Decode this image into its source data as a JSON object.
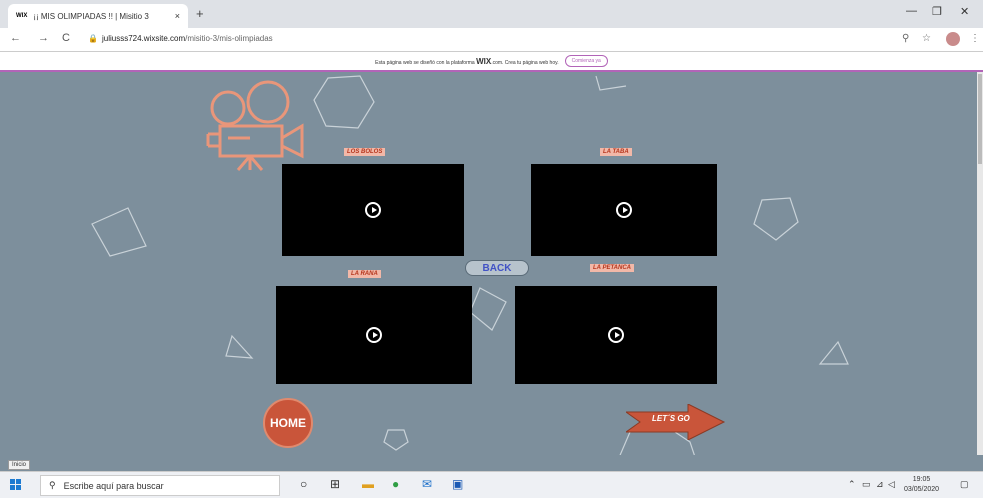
{
  "browser": {
    "tab_favicon": "WIX",
    "tab_title": "¡¡ MIS OLIMPIADAS !! | Misitio 3",
    "tab_close": "×",
    "new_tab": "+",
    "minimize": "—",
    "maximize": "❐",
    "close": "✕",
    "back": "←",
    "forward": "→",
    "reload": "C",
    "url_host": "juliusss724.wixsite.com",
    "url_path": "/misitio-3/mis-olimpiadas",
    "zoom_icon": "⚲",
    "star_icon": "☆",
    "menu_icon": "⋮"
  },
  "wix_banner": {
    "text_before": "Esta página web se diseñó con la plataforma",
    "brand": "WIX",
    "text_after": ".com. Crea tu página web hoy.",
    "cta": "Comienza ya"
  },
  "page": {
    "videos": [
      {
        "label": "LOS BOLOS"
      },
      {
        "label": "LA TABA"
      },
      {
        "label": "LA RANA"
      },
      {
        "label": "LA PETANCA"
      }
    ],
    "back_label": "BACK",
    "home_label": "HOME",
    "letsgo_label": "LET´S GO"
  },
  "tooltip": "Inicio",
  "taskbar": {
    "search_placeholder": "Escribe aquí para buscar",
    "time": "19:05",
    "date": "03/05/2020"
  },
  "colors": {
    "page_bg": "#7d8f9c",
    "accent": "#e9967a",
    "home_button": "#c9553a",
    "back_text": "#4152c5"
  }
}
